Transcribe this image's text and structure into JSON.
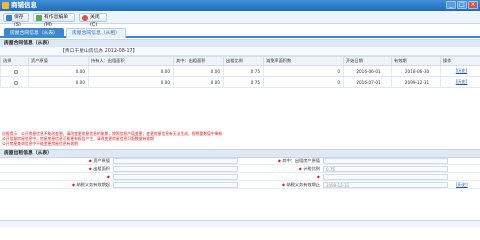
{
  "window": {
    "title": "商铺信息"
  },
  "toolbar": {
    "save_label": "保存(S)",
    "reset_label": "有作息编单(M)",
    "close_label": "关闭(C)"
  },
  "tabs": [
    {
      "label": "房屋合同信息（从表）"
    },
    {
      "label": "房屋合同信息（从租）"
    }
  ],
  "contract_section": {
    "title": "房屋合同信息（从表）",
    "subtitle": "【青口干星山房信办 2012-08-17】",
    "columns": [
      "选择",
      "资产原值",
      "持有人：出租面积",
      "其中：出租面积",
      "出租比例",
      "减免率面积数",
      "开始日期",
      "有效期",
      "操作"
    ],
    "rows": [
      {
        "asset": "0.00",
        "held": "0.00",
        "area": "0.00",
        "ratio": "0.75",
        "reduce": "0",
        "start": "2016-06-01",
        "end": "2018-06-30",
        "action": "[历史]"
      },
      {
        "asset": "0.00",
        "held": "0.00",
        "area": "0.00",
        "ratio": "0.75",
        "reduce": "0",
        "start": "2016-07-01",
        "end": "2099-12-31",
        "action": "[历史]"
      }
    ]
  },
  "warning": {
    "lines": [
      "自报提示：公开房屋信息不能改变更，请改变更房屋信息的账期，按照信息产值变更；变更房屋信息有无法生成，报税整数值中果新",
      "公开批量房屋信息中，房屋房屋信息可能更有报告产生；请改变更房屋信息可报数据有效期",
      "公开房屋查询信息中不能变更房屋信息有效期"
    ]
  },
  "form_section": {
    "title": "房屋出租信息（从表）",
    "rows": [
      {
        "left_label": "资产原值",
        "left_value": "",
        "right_label": "其中：出租房产原值",
        "right_value": ""
      },
      {
        "left_label": "出租面积",
        "left_value": "",
        "right_label": "计税比例",
        "right_value": "0.75"
      },
      {
        "left_label": "",
        "left_value": "",
        "right_label": "",
        "right_value": ""
      },
      {
        "left_label": "纳税义务有效期起",
        "left_value": "",
        "right_label": "纳税义务有效期止",
        "right_value": "2099-12-31"
      }
    ],
    "action": "[历史]"
  },
  "colors": {
    "accent": "#3b87d0",
    "warning": "#d61d1d",
    "link": "#1a55b8"
  }
}
